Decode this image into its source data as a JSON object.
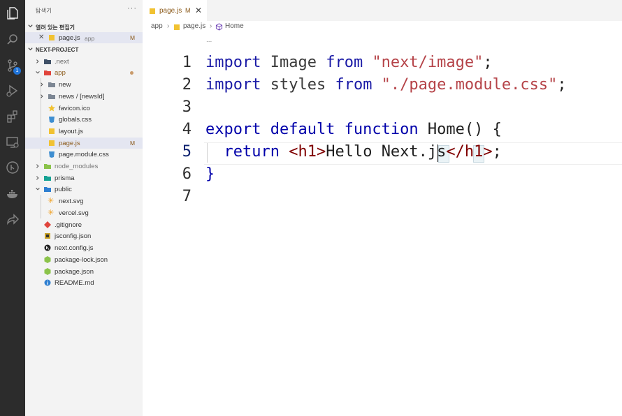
{
  "activity_bar": {
    "icons": [
      "explorer-icon",
      "search-icon",
      "source-control-icon",
      "run-debug-icon",
      "extensions-icon",
      "remote-explorer-icon",
      "git-graph-icon",
      "docker-icon",
      "live-share-icon"
    ],
    "scm_badge": "1"
  },
  "sidebar": {
    "title": "탐색기",
    "more": "···",
    "open_editors": {
      "header": "열려 있는 편집기",
      "item": {
        "name": "page.js",
        "folder": "app",
        "status": "M"
      }
    },
    "project": {
      "header": "NEXT-PROJECT",
      "items": [
        {
          "label": ".next",
          "type": "folder"
        },
        {
          "label": "app",
          "type": "folder"
        },
        {
          "label": "new",
          "type": "folder"
        },
        {
          "label": "news / [newsId]",
          "type": "folder"
        },
        {
          "label": "favicon.ico",
          "type": "file"
        },
        {
          "label": "globals.css",
          "type": "file"
        },
        {
          "label": "layout.js",
          "type": "file"
        },
        {
          "label": "page.js",
          "type": "file",
          "status": "M"
        },
        {
          "label": "page.module.css",
          "type": "file"
        },
        {
          "label": "node_modules",
          "type": "folder"
        },
        {
          "label": "prisma",
          "type": "folder"
        },
        {
          "label": "public",
          "type": "folder"
        },
        {
          "label": "next.svg",
          "type": "file"
        },
        {
          "label": "vercel.svg",
          "type": "file"
        },
        {
          "label": ".gitignore",
          "type": "file"
        },
        {
          "label": "jsconfig.json",
          "type": "file"
        },
        {
          "label": "next.config.js",
          "type": "file"
        },
        {
          "label": "package-lock.json",
          "type": "file"
        },
        {
          "label": "package.json",
          "type": "file"
        },
        {
          "label": "README.md",
          "type": "file"
        }
      ]
    }
  },
  "editor": {
    "tab": {
      "name": "page.js",
      "status": "M",
      "close": "✕"
    },
    "breadcrumb": [
      "app",
      "page.js",
      "Home"
    ],
    "fold_hint": "...",
    "line_numbers": [
      "1",
      "2",
      "3",
      "4",
      "5",
      "6",
      "7"
    ],
    "code": {
      "l1": {
        "kw": "import",
        "id": " Image ",
        "kw2": "from",
        "str": " \"next/image\"",
        "end": ";"
      },
      "l2": {
        "kw": "import",
        "id": " styles ",
        "kw2": "from",
        "str": " \"./page.module.css\"",
        "end": ";"
      },
      "l4": {
        "kw": "export default function",
        "fn": " Home",
        "rest": "() {"
      },
      "l5": {
        "kw": "return",
        "sp": " ",
        "tag1": "<h1>",
        "text": "Hello Next.js",
        "tag2": "</h1>",
        "end": ";"
      },
      "l6": "}"
    }
  }
}
